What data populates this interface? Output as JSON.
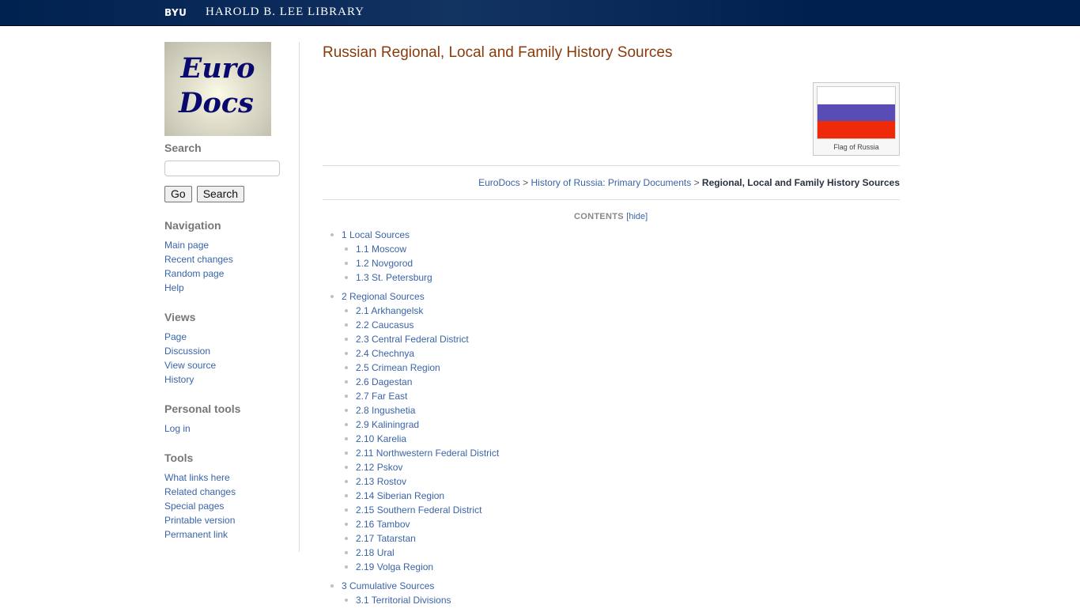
{
  "topbar": {
    "byu": "BYU",
    "library": "HAROLD B. LEE LIBRARY"
  },
  "sidebar": {
    "logo": {
      "line1": "Euro",
      "line2": "Docs"
    },
    "search": {
      "heading": "Search",
      "value": "",
      "placeholder": "",
      "go_label": "Go",
      "search_label": "Search"
    },
    "navigation": {
      "heading": "Navigation",
      "items": [
        "Main page",
        "Recent changes",
        "Random page",
        "Help"
      ]
    },
    "views": {
      "heading": "Views",
      "items": [
        "Page",
        "Discussion",
        "View source",
        "History"
      ]
    },
    "personal_tools": {
      "heading": "Personal tools",
      "items": [
        "Log in"
      ]
    },
    "tools": {
      "heading": "Tools",
      "items": [
        "What links here",
        "Related changes",
        "Special pages",
        "Printable version",
        "Permanent link"
      ]
    }
  },
  "content": {
    "title": "Russian Regional, Local and Family History Sources",
    "flag": {
      "caption": "Flag of Russia",
      "colors": [
        "#ffffff",
        "#5a4cb5",
        "#ee2a0a"
      ]
    },
    "breadcrumb": {
      "items": [
        "EuroDocs",
        "History of Russia: Primary Documents"
      ],
      "separator": ">",
      "current": "Regional, Local and Family History Sources"
    },
    "toc": {
      "heading": "CONTENTS",
      "toggle_label": "[hide]",
      "sections": [
        {
          "label": "1 Local Sources",
          "children": [
            "1.1 Moscow",
            "1.2 Novgorod",
            "1.3 St. Petersburg"
          ]
        },
        {
          "label": "2 Regional Sources",
          "children": [
            "2.1 Arkhangelsk",
            "2.2 Caucasus",
            "2.3 Central Federal District",
            "2.4 Chechnya",
            "2.5 Crimean Region",
            "2.6 Dagestan",
            "2.7 Far East",
            "2.8 Ingushetia",
            "2.9 Kaliningrad",
            "2.10 Karelia",
            "2.11 Northwestern Federal District",
            "2.12 Pskov",
            "2.13 Rostov",
            "2.14 Siberian Region",
            "2.15 Southern Federal District",
            "2.16 Tambov",
            "2.17 Tatarstan",
            "2.18 Ural",
            "2.19 Volga Region"
          ]
        },
        {
          "label": "3 Cumulative Sources",
          "children": [
            "3.1 Territorial Divisions"
          ]
        }
      ]
    }
  },
  "colors": {
    "header_bg": "#002150",
    "link": "#3a64a8",
    "title": "#8a3b0c",
    "portlet_heading": "#777777"
  }
}
